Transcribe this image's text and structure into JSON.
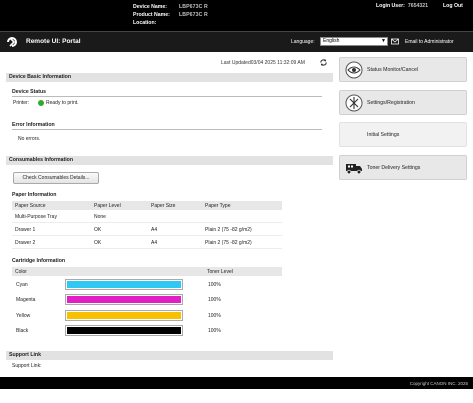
{
  "header": {
    "device_name_label": "Device Name:",
    "device_name_value": "LBP673C R",
    "product_name_label": "Product Name:",
    "product_name_value": "LBP673C R",
    "location_label": "Location:",
    "login_user_label": "Login User:",
    "login_user_value": "7654321",
    "logout_label": "Log Out"
  },
  "portal": {
    "title": "Remote UI: Portal",
    "language_label": "Language:",
    "language_value": "English",
    "admin_link": "Email to Administrator"
  },
  "main": {
    "last_updated": "Last Updated03/04 2025 11:32:09 AM"
  },
  "device_basic": {
    "section_title": "Device Basic Information",
    "status_title": "Device Status",
    "printer_label": "Printer:",
    "printer_status": "Ready to print.",
    "error_title": "Error Information",
    "error_text": "No errors."
  },
  "consumables": {
    "section_title": "Consumables Information",
    "details_button": "Check Consumables Details...",
    "paper_title": "Paper Information",
    "paper_headers": [
      "Paper Source",
      "Paper Level",
      "Paper Size",
      "Paper Type"
    ],
    "paper_rows": [
      [
        "Multi-Purpose Tray",
        "None",
        "",
        ""
      ],
      [
        "Drawer 1",
        "OK",
        "A4",
        "Plain 2 (75 -82 g/m2)"
      ],
      [
        "Drawer 2",
        "OK",
        "A4",
        "Plain 2 (75 -82 g/m2)"
      ]
    ],
    "cartridge_title": "Cartridge Information",
    "cartridge_headers": [
      "Color",
      "Toner Level"
    ],
    "cartridges": [
      {
        "color": "Cyan",
        "level": "100%",
        "level_fraction": 1.0,
        "hex": "#2ec8f2"
      },
      {
        "color": "Magenta",
        "level": "100%",
        "level_fraction": 1.0,
        "hex": "#e21fc5"
      },
      {
        "color": "Yellow",
        "level": "100%",
        "level_fraction": 1.0,
        "hex": "#f7c000"
      },
      {
        "color": "Black",
        "level": "100%",
        "level_fraction": 1.0,
        "hex": "#000000"
      }
    ]
  },
  "support": {
    "section_title": "Support Link",
    "link_label": "Support Link:"
  },
  "right_menu": [
    {
      "label": "Status Monitor/Cancel",
      "icon": "status-monitor-icon"
    },
    {
      "label": "Settings/Registration",
      "icon": "settings-registration-icon"
    },
    {
      "label": "Initial Settings",
      "icon": ""
    },
    {
      "label": "Toner Delivery Settings",
      "icon": "truck-icon"
    }
  ],
  "footer": {
    "copyright": "Copyright CANON INC. 2025"
  },
  "colors": {
    "header_bg": "#000000",
    "section_bg": "#e2e2e2",
    "ready_green": "#2eaa2e"
  }
}
